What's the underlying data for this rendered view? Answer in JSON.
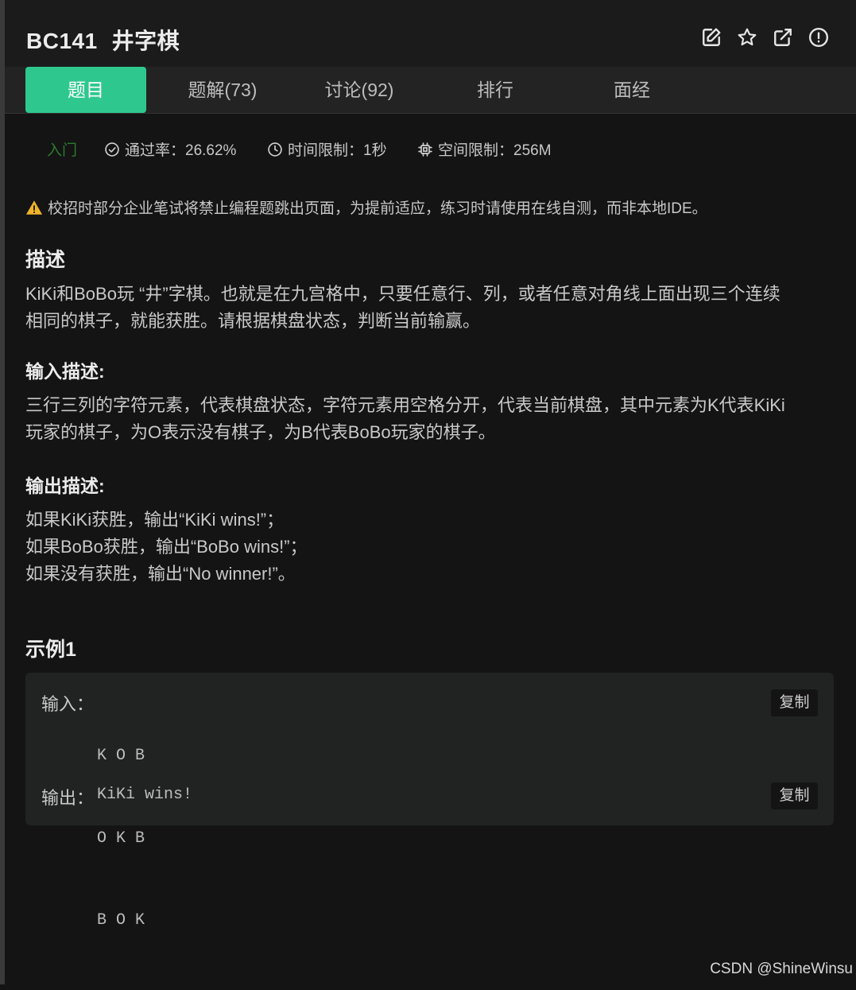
{
  "header": {
    "problem_id": "BC141",
    "problem_name": "井字棋",
    "icons": [
      "edit-icon",
      "star-icon",
      "external-link-icon",
      "alert-circle-icon"
    ]
  },
  "tabs": [
    {
      "label": "题目",
      "active": true
    },
    {
      "label": "题解(73)"
    },
    {
      "label": "讨论(92)"
    },
    {
      "label": "排行"
    },
    {
      "label": "面经"
    }
  ],
  "meta": {
    "level": "入门",
    "pass_rate": "通过率：26.62%",
    "time_limit": "时间限制：1秒",
    "space_limit": "空间限制：256M"
  },
  "notice": "校招时部分企业笔试将禁止编程题跳出页面，为提前适应，练习时请使用在线自测，而非本地IDE。",
  "description": {
    "heading": "描述",
    "lines": [
      "KiKi和BoBo玩 “井”字棋。也就是在九宫格中，只要任意行、列，或者任意对角线上面出现三个连续",
      "相同的棋子，就能获胜。请根据棋盘状态，判断当前输赢。"
    ]
  },
  "input_desc": {
    "heading": "输入描述:",
    "lines": [
      "三行三列的字符元素，代表棋盘状态，字符元素用空格分开，代表当前棋盘，其中元素为K代表KiKi",
      "玩家的棋子，为O表示没有棋子，为B代表BoBo玩家的棋子。"
    ]
  },
  "output_desc": {
    "heading": "输出描述:",
    "lines": [
      "如果KiKi获胜，输出“KiKi wins!”；",
      "如果BoBo获胜，输出“BoBo wins!”；",
      "如果没有获胜，输出“No winner!”。"
    ]
  },
  "example": {
    "heading": "示例1",
    "input_label": "输入：",
    "input_lines": [
      "K O B",
      "O K B",
      "B O K"
    ],
    "output_label": "输出：",
    "output_value": "KiKi wins!",
    "copy_label": "复制"
  },
  "watermark": "CSDN @ShineWinsu",
  "colors": {
    "accent": "#2ec88f",
    "background": "#141414",
    "level": "#2e7a2e",
    "warning": "#f0b429"
  }
}
